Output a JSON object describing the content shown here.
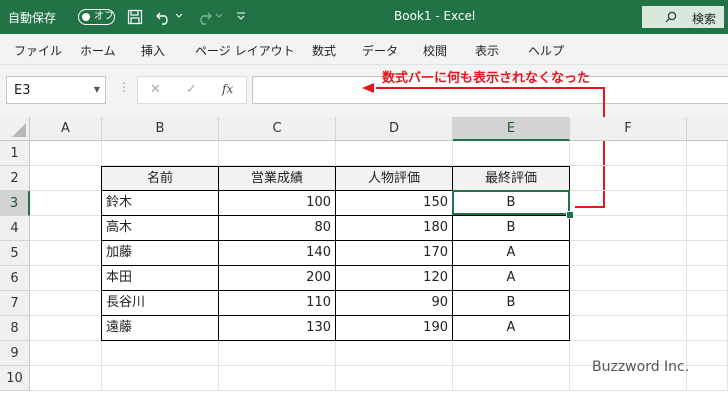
{
  "titlebar": {
    "autosave_label": "自動保存",
    "autosave_state": "オフ",
    "doc_title": "Book1  -  Excel",
    "search_label": "検索",
    "color": "#217346"
  },
  "ribbon": {
    "tabs": [
      "ファイル",
      "ホーム",
      "挿入",
      "ページ レイアウト",
      "数式",
      "データ",
      "校閲",
      "表示",
      "ヘルプ"
    ]
  },
  "formula_bar": {
    "name_box": "E3",
    "fx_label": "fx",
    "formula": ""
  },
  "annotation": {
    "text": "数式バーに何も表示されなくなった",
    "color": "#e8141f"
  },
  "columns": [
    "A",
    "B",
    "C",
    "D",
    "E",
    "F"
  ],
  "rows": [
    "1",
    "2",
    "3",
    "4",
    "5",
    "6",
    "7",
    "8",
    "9",
    "10"
  ],
  "table": {
    "headers": [
      "名前",
      "営業成績",
      "人物評価",
      "最終評価"
    ],
    "records": [
      [
        "鈴木",
        "100",
        "150",
        "B"
      ],
      [
        "高木",
        "80",
        "180",
        "B"
      ],
      [
        "加藤",
        "140",
        "170",
        "A"
      ],
      [
        "本田",
        "200",
        "120",
        "A"
      ],
      [
        "長谷川",
        "110",
        "90",
        "B"
      ],
      [
        "遠藤",
        "130",
        "190",
        "A"
      ]
    ]
  },
  "watermark": "Buzzword Inc."
}
